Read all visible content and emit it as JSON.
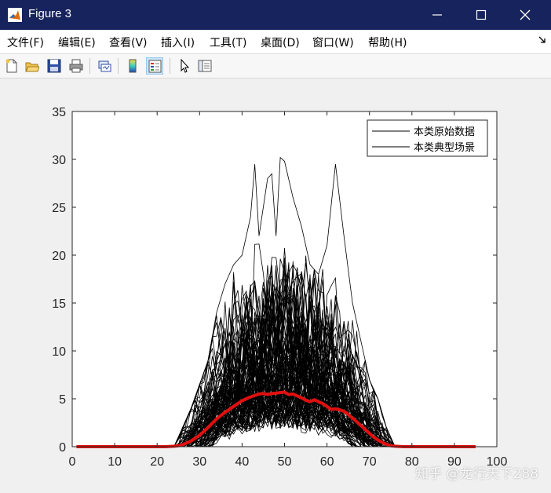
{
  "window": {
    "title": "Figure 3",
    "titlebar_color": "#17235c"
  },
  "menu": {
    "items": [
      {
        "label": "文件(F)"
      },
      {
        "label": "编辑(E)"
      },
      {
        "label": "查看(V)"
      },
      {
        "label": "插入(I)"
      },
      {
        "label": "工具(T)"
      },
      {
        "label": "桌面(D)"
      },
      {
        "label": "窗口(W)"
      },
      {
        "label": "帮助(H)"
      }
    ]
  },
  "toolbar": {
    "icons": [
      "new-figure-icon",
      "open-file-icon",
      "save-icon",
      "print-icon",
      "link-plot-icon",
      "colorbar-icon",
      "legend-icon",
      "pointer-icon",
      "property-editor-icon"
    ]
  },
  "watermark": "知乎 @龙行天下288",
  "chart_data": {
    "type": "line",
    "title": "",
    "xlabel": "",
    "ylabel": "",
    "xlim": [
      0,
      100
    ],
    "ylim": [
      0,
      35
    ],
    "xticks": [
      "0",
      "10",
      "20",
      "30",
      "40",
      "50",
      "60",
      "70",
      "80",
      "90",
      "100"
    ],
    "yticks": [
      "0",
      "5",
      "10",
      "15",
      "20",
      "25",
      "30",
      "35"
    ],
    "grid": false,
    "legend": {
      "position": "top-right",
      "entries": [
        "本类原始数据",
        "本类典型场景"
      ]
    },
    "series": [
      {
        "name": "本类原始数据",
        "color": "#000000",
        "note_count": 100,
        "envelope_max": {
          "x": [
            24,
            28,
            32,
            34,
            36,
            38,
            40,
            42,
            43,
            44,
            46,
            47,
            48,
            49,
            50,
            52,
            54,
            56,
            58,
            60,
            62,
            64,
            66,
            68,
            70,
            72,
            74,
            76
          ],
          "y": [
            0,
            4,
            9,
            14,
            17,
            19,
            20,
            24,
            29.5,
            22,
            28,
            28.5,
            22,
            30.2,
            29.8,
            26,
            23,
            19,
            18,
            21,
            29.5,
            22,
            15,
            11,
            7,
            5,
            2,
            0
          ]
        }
      },
      {
        "name": "本类典型场景",
        "color": "#e01010",
        "x": [
          1,
          5,
          10,
          15,
          20,
          22,
          24,
          25,
          26,
          28,
          30,
          32,
          34,
          36,
          38,
          40,
          41,
          42,
          43,
          44,
          45,
          46,
          47,
          48,
          49,
          50,
          51,
          52,
          53,
          54,
          55,
          56,
          57,
          58,
          59,
          60,
          61,
          62,
          63,
          64,
          65,
          66,
          67,
          68,
          69,
          70,
          71,
          72,
          73,
          74,
          75,
          76,
          78,
          80,
          85,
          90,
          95
        ],
        "y": [
          0,
          0,
          0,
          0,
          0,
          0,
          0.05,
          0.1,
          0.2,
          0.6,
          1.2,
          2.0,
          2.9,
          3.6,
          4.2,
          4.8,
          5.0,
          5.2,
          5.35,
          5.5,
          5.55,
          5.45,
          5.55,
          5.6,
          5.65,
          5.7,
          5.45,
          5.5,
          5.3,
          5.1,
          4.85,
          4.7,
          4.9,
          4.7,
          4.5,
          4.2,
          3.9,
          3.95,
          3.85,
          3.7,
          3.35,
          3.0,
          2.6,
          2.2,
          1.8,
          1.4,
          1.0,
          0.7,
          0.45,
          0.25,
          0.1,
          0.05,
          0,
          0,
          0,
          0,
          0
        ]
      }
    ]
  }
}
